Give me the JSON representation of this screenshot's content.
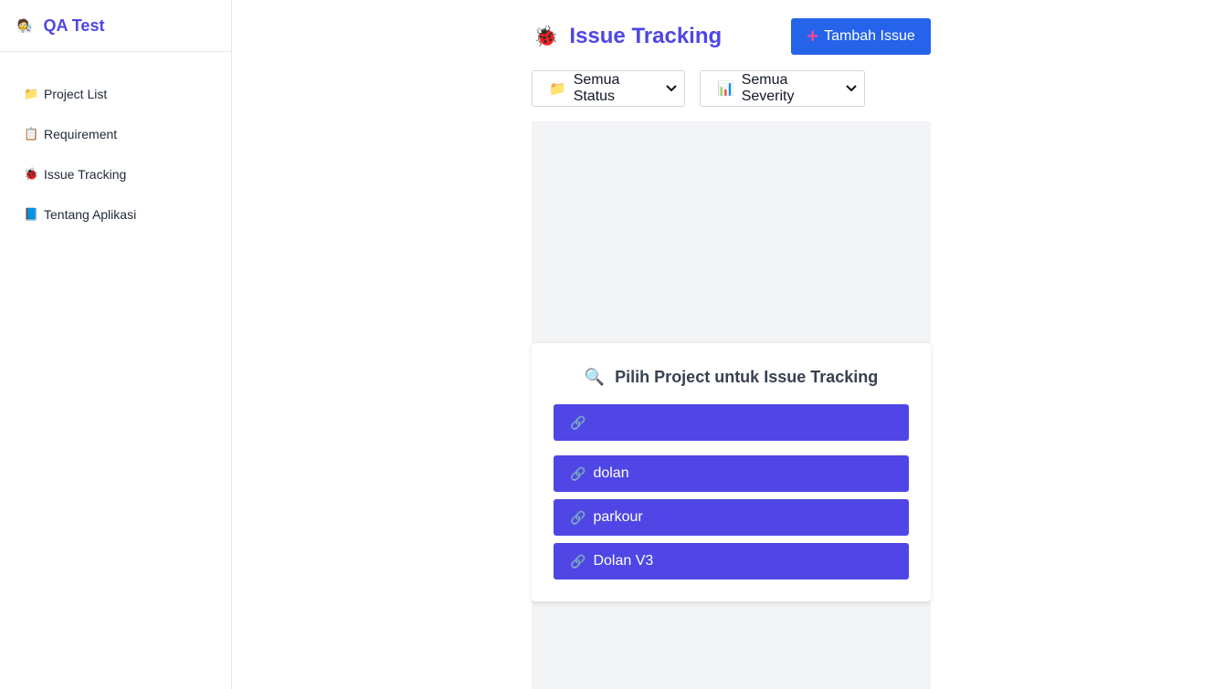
{
  "sidebar": {
    "brand_icon": "🧑‍🔬",
    "brand": "QA Test",
    "items": [
      {
        "icon": "📁",
        "label": "Project List"
      },
      {
        "icon": "📋",
        "label": "Requirement"
      },
      {
        "icon": "🐞",
        "label": "Issue Tracking"
      },
      {
        "icon": "📘",
        "label": "Tentang Aplikasi"
      }
    ]
  },
  "header": {
    "title_icon": "🐞",
    "title": "Issue Tracking",
    "add_icon": "+",
    "add_label": "Tambah Issue"
  },
  "filters": {
    "status_icon": "📁",
    "status_value": "Semua Status",
    "severity_icon": "📊",
    "severity_value": "Semua Severity",
    "chevron": "⌄"
  },
  "card": {
    "title_icon": "🔍",
    "title": "Pilih Project untuk Issue Tracking",
    "link_icon": "🔗",
    "projects": [
      "",
      "dolan",
      "parkour",
      "Dolan V3"
    ]
  },
  "colors": {
    "accent": "#4f46e5",
    "primary_button": "#2563eb",
    "content_bg": "#f3f4f6"
  }
}
